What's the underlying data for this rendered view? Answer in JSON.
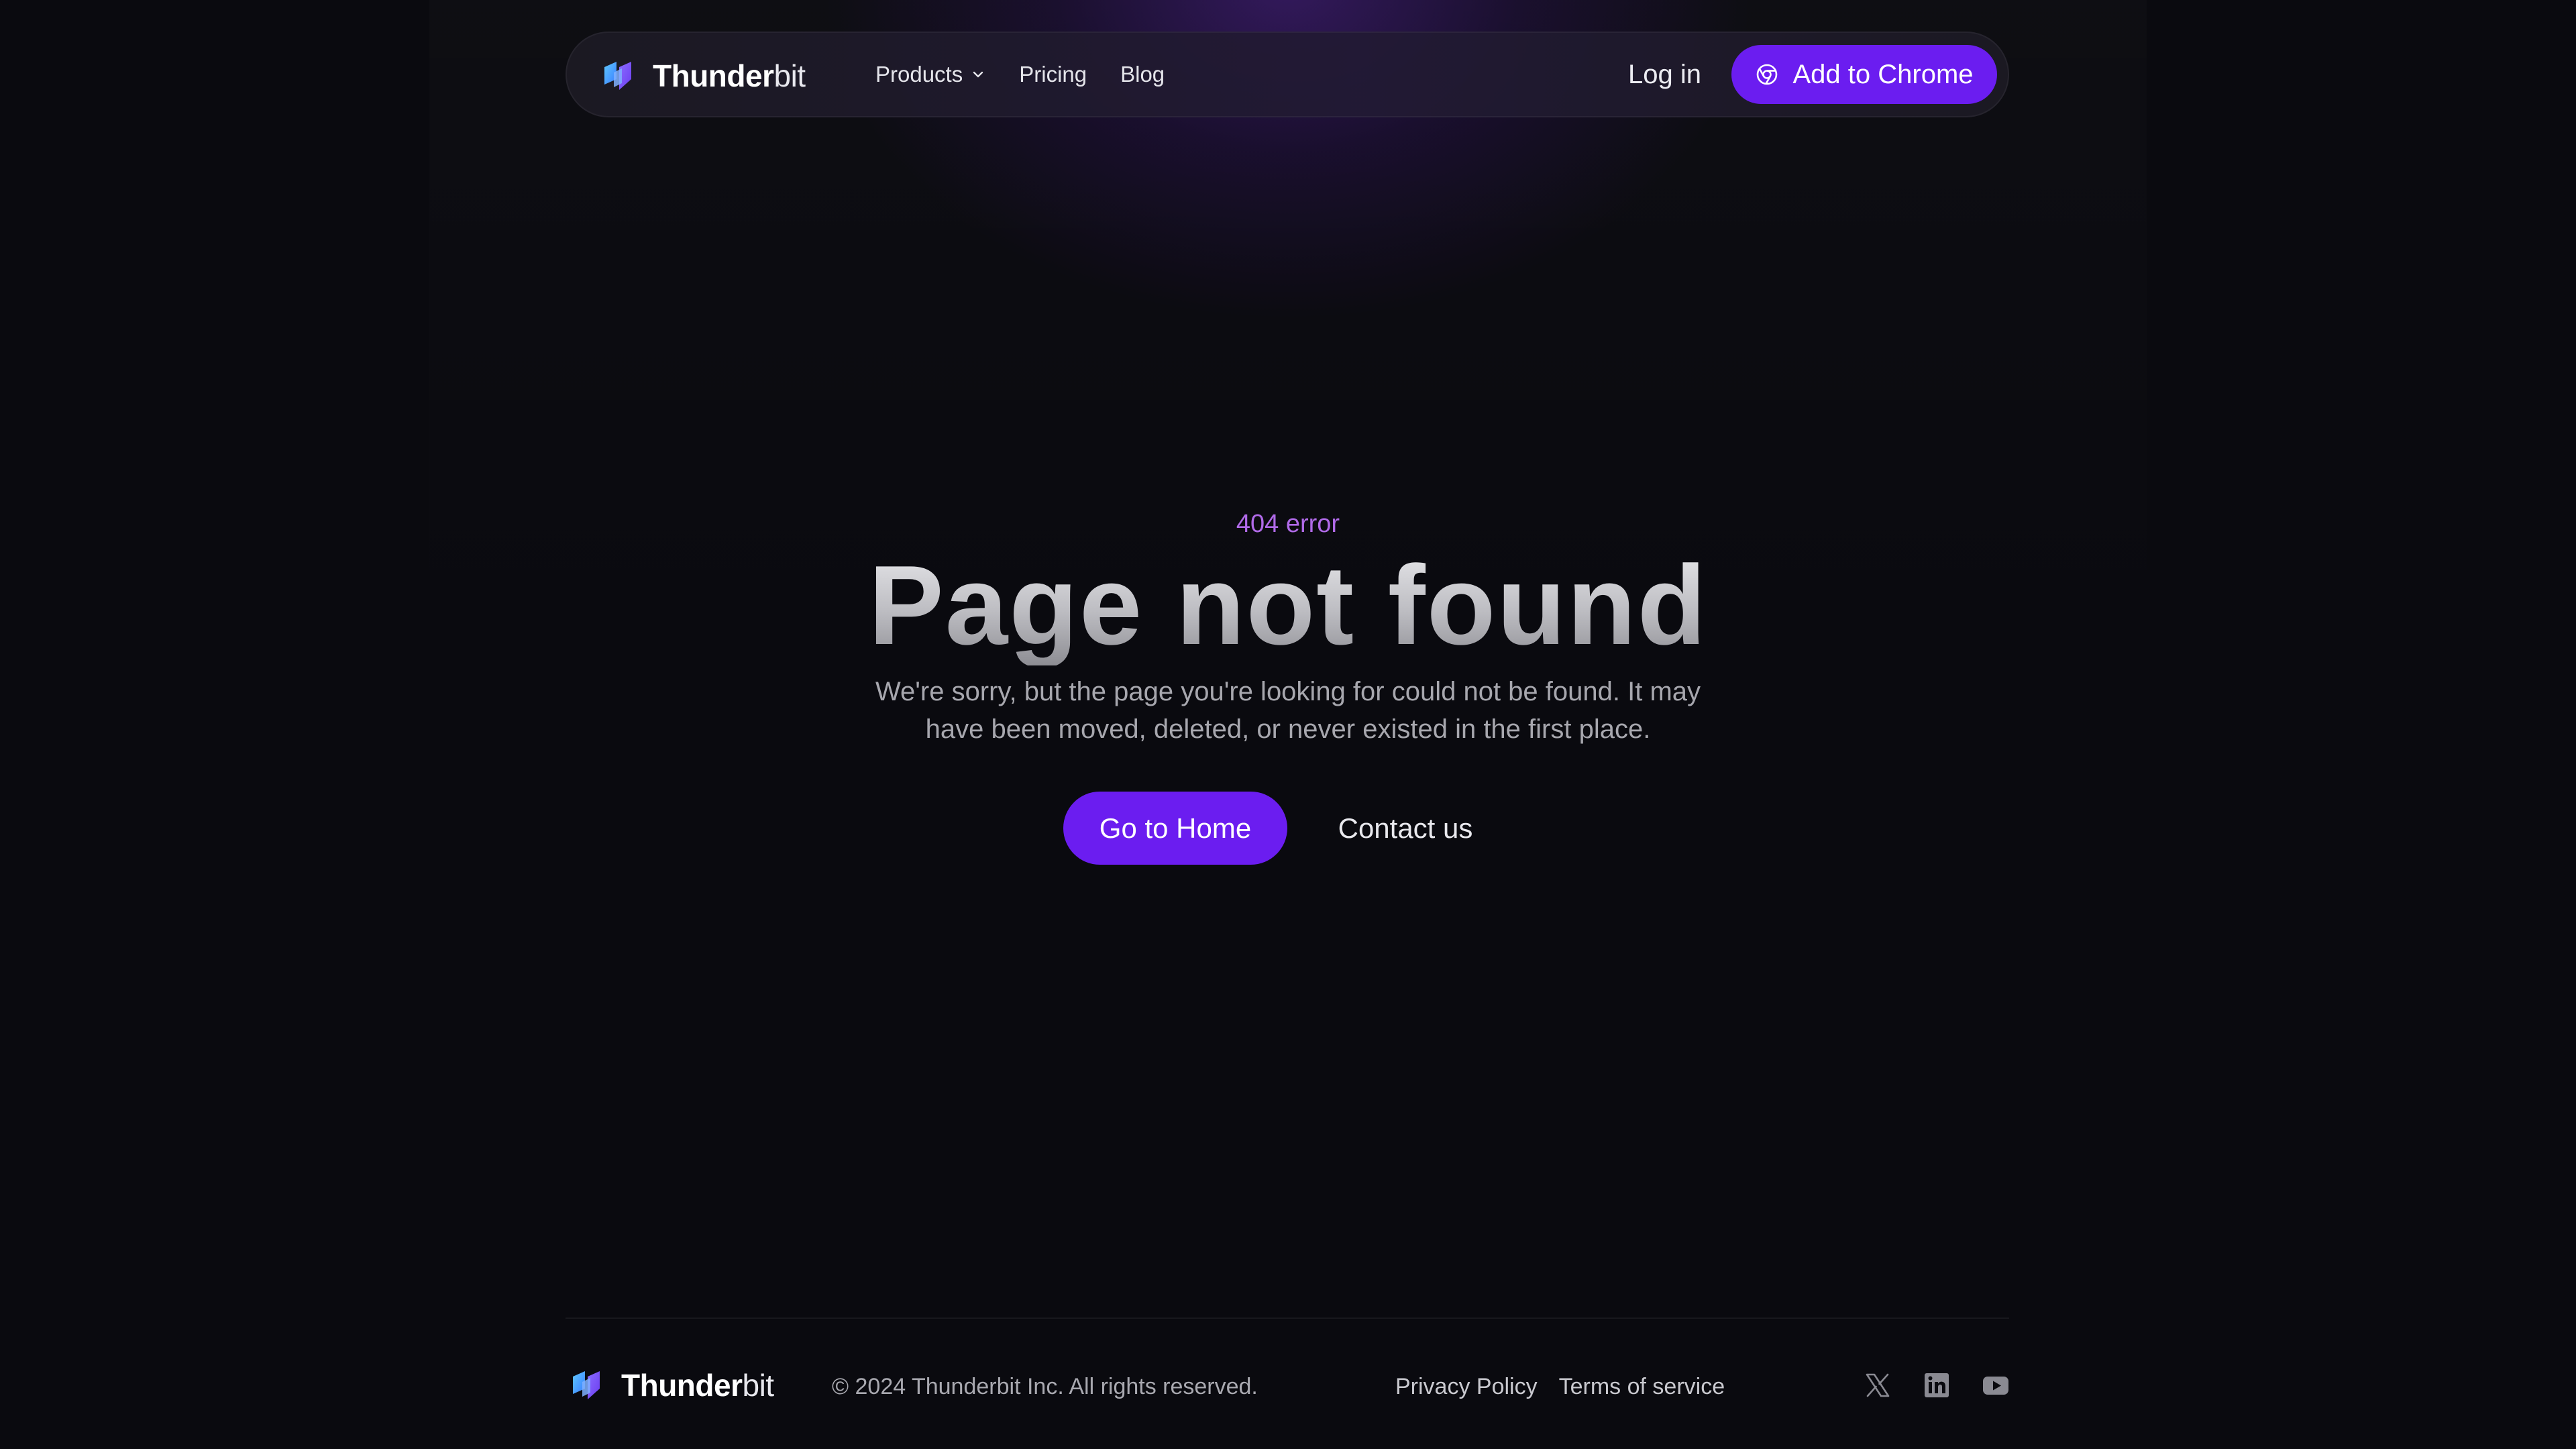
{
  "header": {
    "brand": {
      "strong": "Thunder",
      "light": "bit",
      "logo_icon": "thunderbit-logo-icon"
    },
    "nav": [
      {
        "label": "Products",
        "has_dropdown": true,
        "icon": "chevron-down-icon"
      },
      {
        "label": "Pricing"
      },
      {
        "label": "Blog"
      }
    ],
    "login_label": "Log in",
    "cta_label": "Add to Chrome",
    "cta_icon": "chrome-icon"
  },
  "main": {
    "eyebrow": "404 error",
    "title": "Page not found",
    "description": "We're sorry, but the page you're looking for could not be found. It may have been moved, deleted, or never existed in the first place.",
    "primary_button": "Go to Home",
    "secondary_button": "Contact us"
  },
  "footer": {
    "brand": {
      "strong": "Thunder",
      "light": "bit"
    },
    "copyright": "© 2024 Thunderbit Inc. All rights reserved.",
    "links": [
      "Privacy Policy",
      "Terms of service"
    ],
    "socials": [
      "x-icon",
      "linkedin-icon",
      "youtube-icon"
    ]
  },
  "colors": {
    "background": "#0a0a0f",
    "accent": "#6b1df0",
    "eyebrow": "#b06ae8"
  }
}
